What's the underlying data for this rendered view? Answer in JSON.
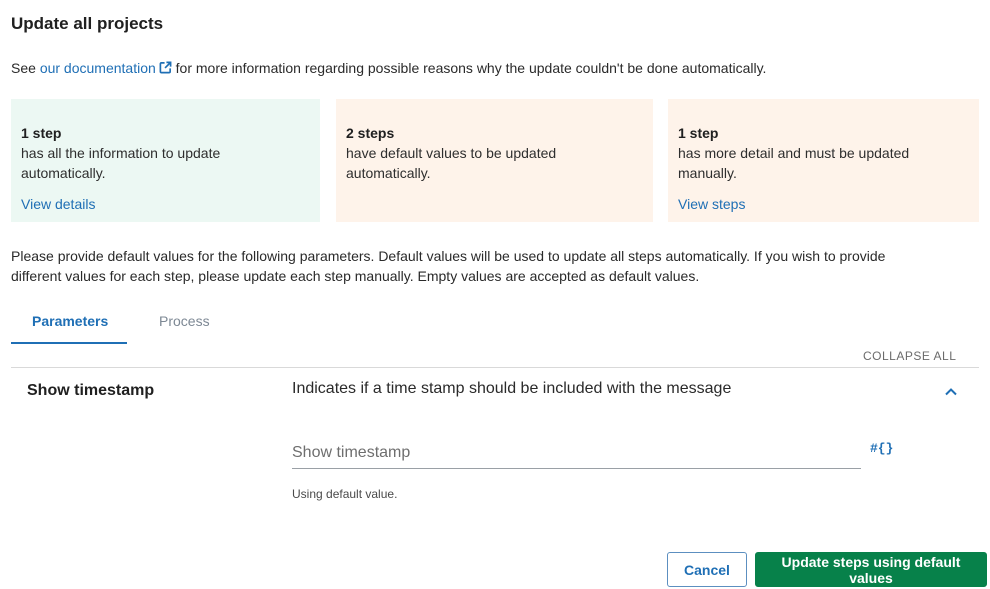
{
  "dialog": {
    "title": "Update all projects"
  },
  "intro": {
    "prefix": "See ",
    "link_text": "our documentation",
    "suffix": " for more information regarding possible reasons why the update couldn't be done automatically.",
    "link_icon": "external-link-icon"
  },
  "cards": [
    {
      "count": "1 step",
      "line1": "has all the information to update",
      "line2": "automatically.",
      "link": "View details",
      "bg": "#ecf8f3"
    },
    {
      "count": "2 steps",
      "line1": "have default values to be updated",
      "line2": "automatically.",
      "link": "",
      "bg": "#fef3ea"
    },
    {
      "count": "1 step",
      "line1": "has more detail and must be updated",
      "line2": "manually.",
      "link": "View steps",
      "bg": "#fef3ea"
    }
  ],
  "instructions": {
    "line1": "Please provide default values for the following parameters. Default values will be used to update all steps automatically. If you wish to provide",
    "line2": "different values for each step, please update each step manually. Empty values are accepted as default values."
  },
  "tabs": [
    {
      "label": "Parameters",
      "active": true
    },
    {
      "label": "Process",
      "active": false
    }
  ],
  "collapse_all": "COLLAPSE ALL",
  "parameter": {
    "name": "Show timestamp",
    "description": "Indicates if a time stamp should be included with the message",
    "input_value": "",
    "input_placeholder": "Show timestamp",
    "expression_icon": "#{}",
    "helper_text": "Using default value.",
    "toggle_icon": "chevron-up-icon"
  },
  "buttons": {
    "cancel": "Cancel",
    "primary": "Update steps using default values"
  },
  "colors": {
    "accent": "#1f6fb5",
    "primary_button": "#07814a",
    "card_green": "#ecf8f3",
    "card_orange": "#fef3ea"
  }
}
